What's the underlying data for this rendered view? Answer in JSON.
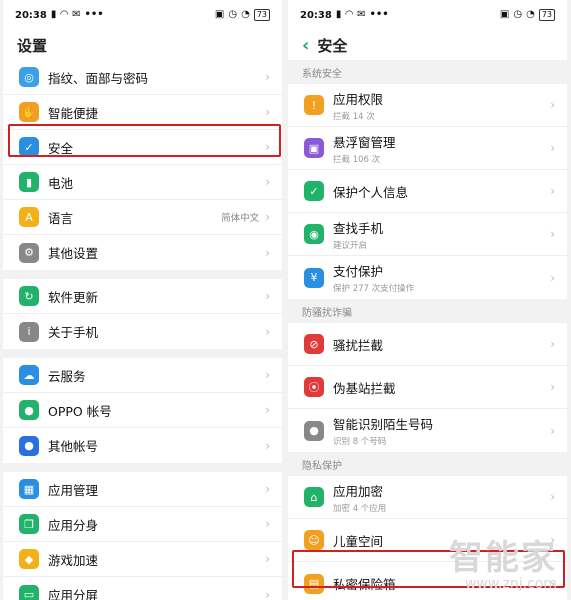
{
  "status_left": {
    "time": "20:38"
  },
  "status_right": {
    "battery": "73"
  },
  "left": {
    "title": "设置",
    "groups": [
      [
        {
          "label": "指纹、面部与密码",
          "icon": "fingerprint-icon",
          "color": "#3aa0e8"
        },
        {
          "label": "智能便捷",
          "icon": "hand-icon",
          "color": "#f0a020"
        },
        {
          "label": "安全",
          "icon": "shield-icon",
          "color": "#2a8fe0"
        },
        {
          "label": "电池",
          "icon": "battery-icon",
          "color": "#22b36a"
        },
        {
          "label": "语言",
          "icon": "language-icon",
          "color": "#f2b118",
          "value": "简体中文"
        },
        {
          "label": "其他设置",
          "icon": "gear-icon",
          "color": "#888888"
        }
      ],
      [
        {
          "label": "软件更新",
          "icon": "update-icon",
          "color": "#22b36a"
        },
        {
          "label": "关于手机",
          "icon": "info-icon",
          "color": "#888888"
        }
      ],
      [
        {
          "label": "云服务",
          "icon": "cloud-icon",
          "color": "#2a8fe0"
        },
        {
          "label": "OPPO 帐号",
          "icon": "user-icon",
          "color": "#22b36a"
        },
        {
          "label": "其他帐号",
          "icon": "user-icon",
          "color": "#2a6fe0"
        }
      ],
      [
        {
          "label": "应用管理",
          "icon": "apps-icon",
          "color": "#2a8fe0"
        },
        {
          "label": "应用分身",
          "icon": "clone-icon",
          "color": "#22b36a"
        },
        {
          "label": "游戏加速",
          "icon": "game-icon",
          "color": "#f2b118"
        },
        {
          "label": "应用分屏",
          "icon": "split-screen-icon",
          "color": "#22b36a"
        }
      ]
    ]
  },
  "right": {
    "title": "安全",
    "sections": [
      {
        "title": "系统安全",
        "items": [
          {
            "label": "应用权限",
            "sub": "拦截 14 次",
            "icon": "permission-icon",
            "color": "#f2a020"
          },
          {
            "label": "悬浮窗管理",
            "sub": "拦截 106 次",
            "icon": "floating-window-icon",
            "color": "#8a5ad8"
          },
          {
            "label": "保护个人信息",
            "sub": "",
            "icon": "privacy-shield-icon",
            "color": "#22b36a"
          },
          {
            "label": "查找手机",
            "sub": "建议开启",
            "icon": "find-phone-icon",
            "color": "#22b36a"
          },
          {
            "label": "支付保护",
            "sub": "保护 277 次支付操作",
            "icon": "payment-shield-icon",
            "color": "#2a8fe0"
          }
        ]
      },
      {
        "title": "防骚扰诈骗",
        "items": [
          {
            "label": "骚扰拦截",
            "sub": "",
            "icon": "block-icon",
            "color": "#e03a3a"
          },
          {
            "label": "伪基站拦截",
            "sub": "",
            "icon": "signal-block-icon",
            "color": "#e03a3a"
          },
          {
            "label": "智能识别陌生号码",
            "sub": "识别 8 个号码",
            "icon": "caller-id-icon",
            "color": "#888888"
          }
        ]
      },
      {
        "title": "隐私保护",
        "items": [
          {
            "label": "应用加密",
            "sub": "加密 4 个应用",
            "icon": "app-lock-icon",
            "color": "#22b36a"
          },
          {
            "label": "儿童空间",
            "sub": "",
            "icon": "child-icon",
            "color": "#f2a020"
          },
          {
            "label": "私密保险箱",
            "sub": "",
            "icon": "safe-box-icon",
            "color": "#f2a020"
          }
        ]
      }
    ]
  },
  "watermark": {
    "brand": "智能家",
    "url": "www.znj.com"
  }
}
